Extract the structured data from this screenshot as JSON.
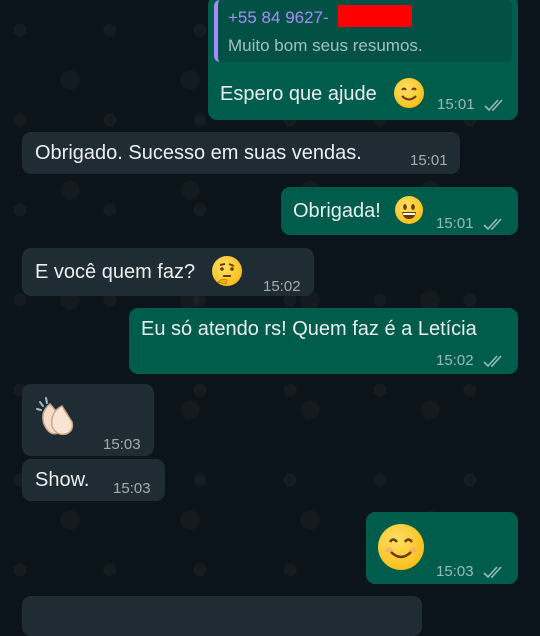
{
  "chat": {
    "messages": [
      {
        "direction": "out",
        "reply_to": {
          "sender": "+55 84 9627-",
          "text": "Muito bom seus resumos."
        },
        "text": "Espero que ajude",
        "emoji": "smiling-face-icon",
        "time": "15:01",
        "status": "read"
      },
      {
        "direction": "in",
        "text": "Obrigado. Sucesso em suas vendas.",
        "time": "15:01"
      },
      {
        "direction": "out",
        "text": "Obrigada!",
        "emoji": "grinning-face-icon",
        "time": "15:01",
        "status": "read"
      },
      {
        "direction": "in",
        "text": "E você quem faz?",
        "emoji": "thinking-face-icon",
        "time": "15:02"
      },
      {
        "direction": "out",
        "text": "Eu só atendo rs! Quem faz é a Letícia",
        "time": "15:02",
        "status": "read"
      },
      {
        "direction": "in",
        "text": "",
        "emoji": "clapping-hands-icon",
        "time": "15:03"
      },
      {
        "direction": "in",
        "text": "Show.",
        "time": "15:03"
      },
      {
        "direction": "out",
        "text": "",
        "emoji": "smiling-face-icon",
        "time": "15:03",
        "status": "read"
      }
    ]
  },
  "colors": {
    "background": "#0b141a",
    "incoming_bubble": "#202c33",
    "outgoing_bubble": "#005c4b",
    "quote_author": "#a78bfa",
    "redaction": "#ff0000"
  }
}
